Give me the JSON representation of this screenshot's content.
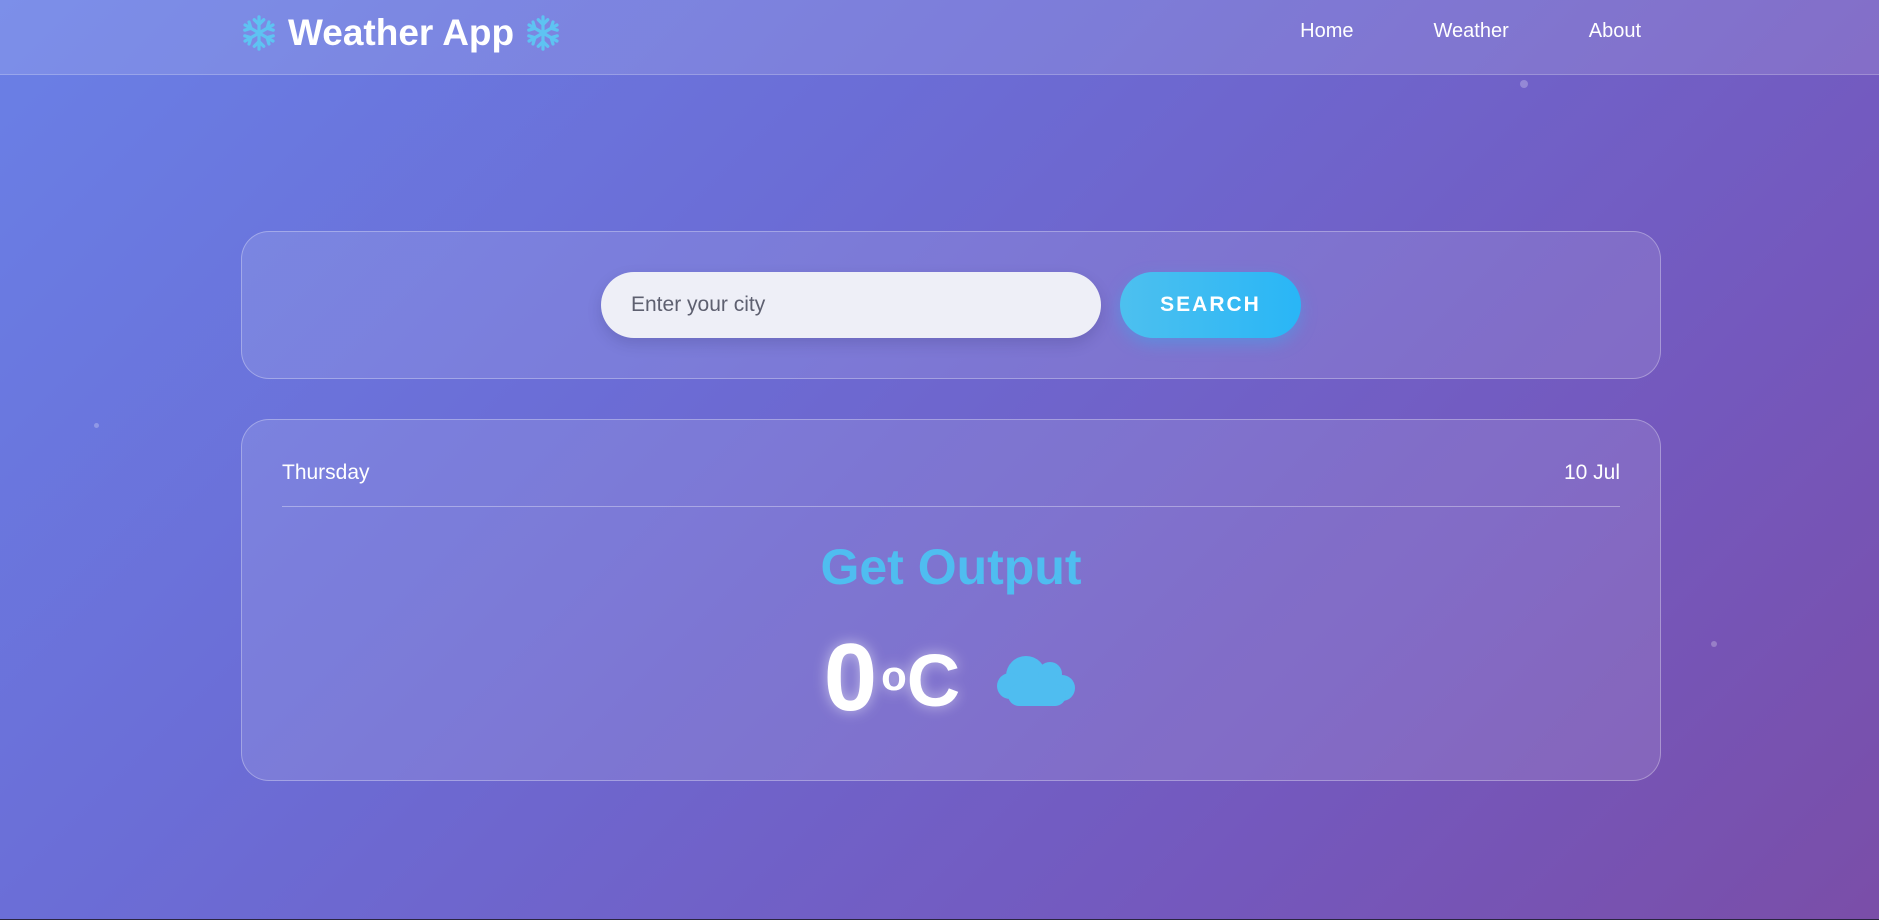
{
  "app": {
    "title": "Weather App",
    "icon": "snowflake-icon"
  },
  "nav": {
    "items": [
      {
        "label": "Home"
      },
      {
        "label": "Weather"
      },
      {
        "label": "About"
      }
    ]
  },
  "search": {
    "placeholder": "Enter your city",
    "value": "",
    "button_label": "SEARCH"
  },
  "weather": {
    "day": "Thursday",
    "date": "10 Jul",
    "city": "Get Output",
    "temperature": "0",
    "degree_symbol": "o",
    "unit": "C",
    "condition_icon": "cloud-icon"
  },
  "colors": {
    "accent": "#4fbdf0",
    "button": "#29b6f6",
    "background_start": "#6a80e6",
    "background_end": "#7a4ea8"
  }
}
